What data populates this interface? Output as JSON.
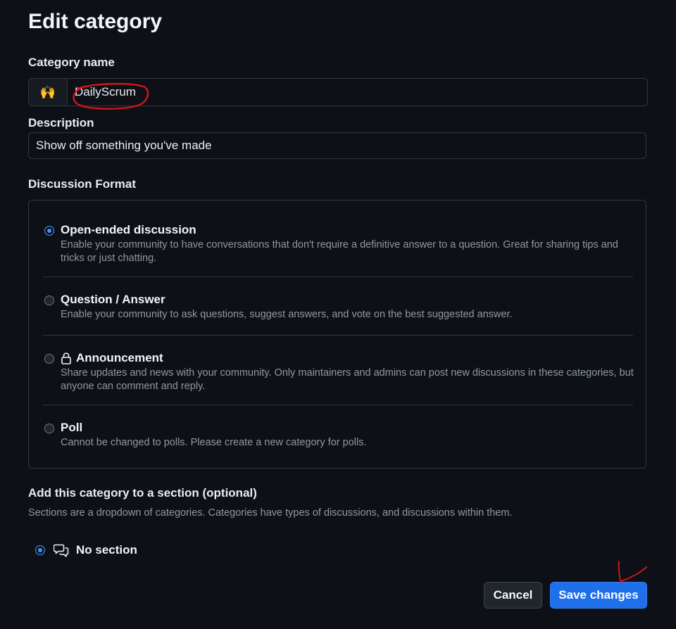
{
  "page": {
    "title": "Edit category"
  },
  "category_name": {
    "label": "Category name",
    "emoji": "🙌",
    "value": "DailyScrum"
  },
  "description": {
    "label": "Description",
    "value": "Show off something you've made"
  },
  "discussion_format": {
    "label": "Discussion Format",
    "options": [
      {
        "title": "Open-ended discussion",
        "description": "Enable your community to have conversations that don't require a definitive answer to a question. Great for sharing tips and tricks or just chatting.",
        "selected": true
      },
      {
        "title": "Question / Answer",
        "description": "Enable your community to ask questions, suggest answers, and vote on the best suggested answer.",
        "selected": false
      },
      {
        "title": "Announcement",
        "description": "Share updates and news with your community. Only maintainers and admins can post new discussions in these categories, but anyone can comment and reply.",
        "icon": "lock-icon",
        "selected": false
      },
      {
        "title": "Poll",
        "description": "Cannot be changed to polls. Please create a new category for polls.",
        "selected": false
      }
    ]
  },
  "section": {
    "label": "Add this category to a section (optional)",
    "help": "Sections are a dropdown of categories. Categories have types of discussions, and discussions within them.",
    "option": {
      "label": "No section",
      "icon": "comment-discussion-icon",
      "selected": true
    }
  },
  "actions": {
    "cancel_label": "Cancel",
    "save_label": "Save changes"
  },
  "colors": {
    "background": "#0d1117",
    "accent": "#1f6feb",
    "annotation": "#e5141b"
  }
}
